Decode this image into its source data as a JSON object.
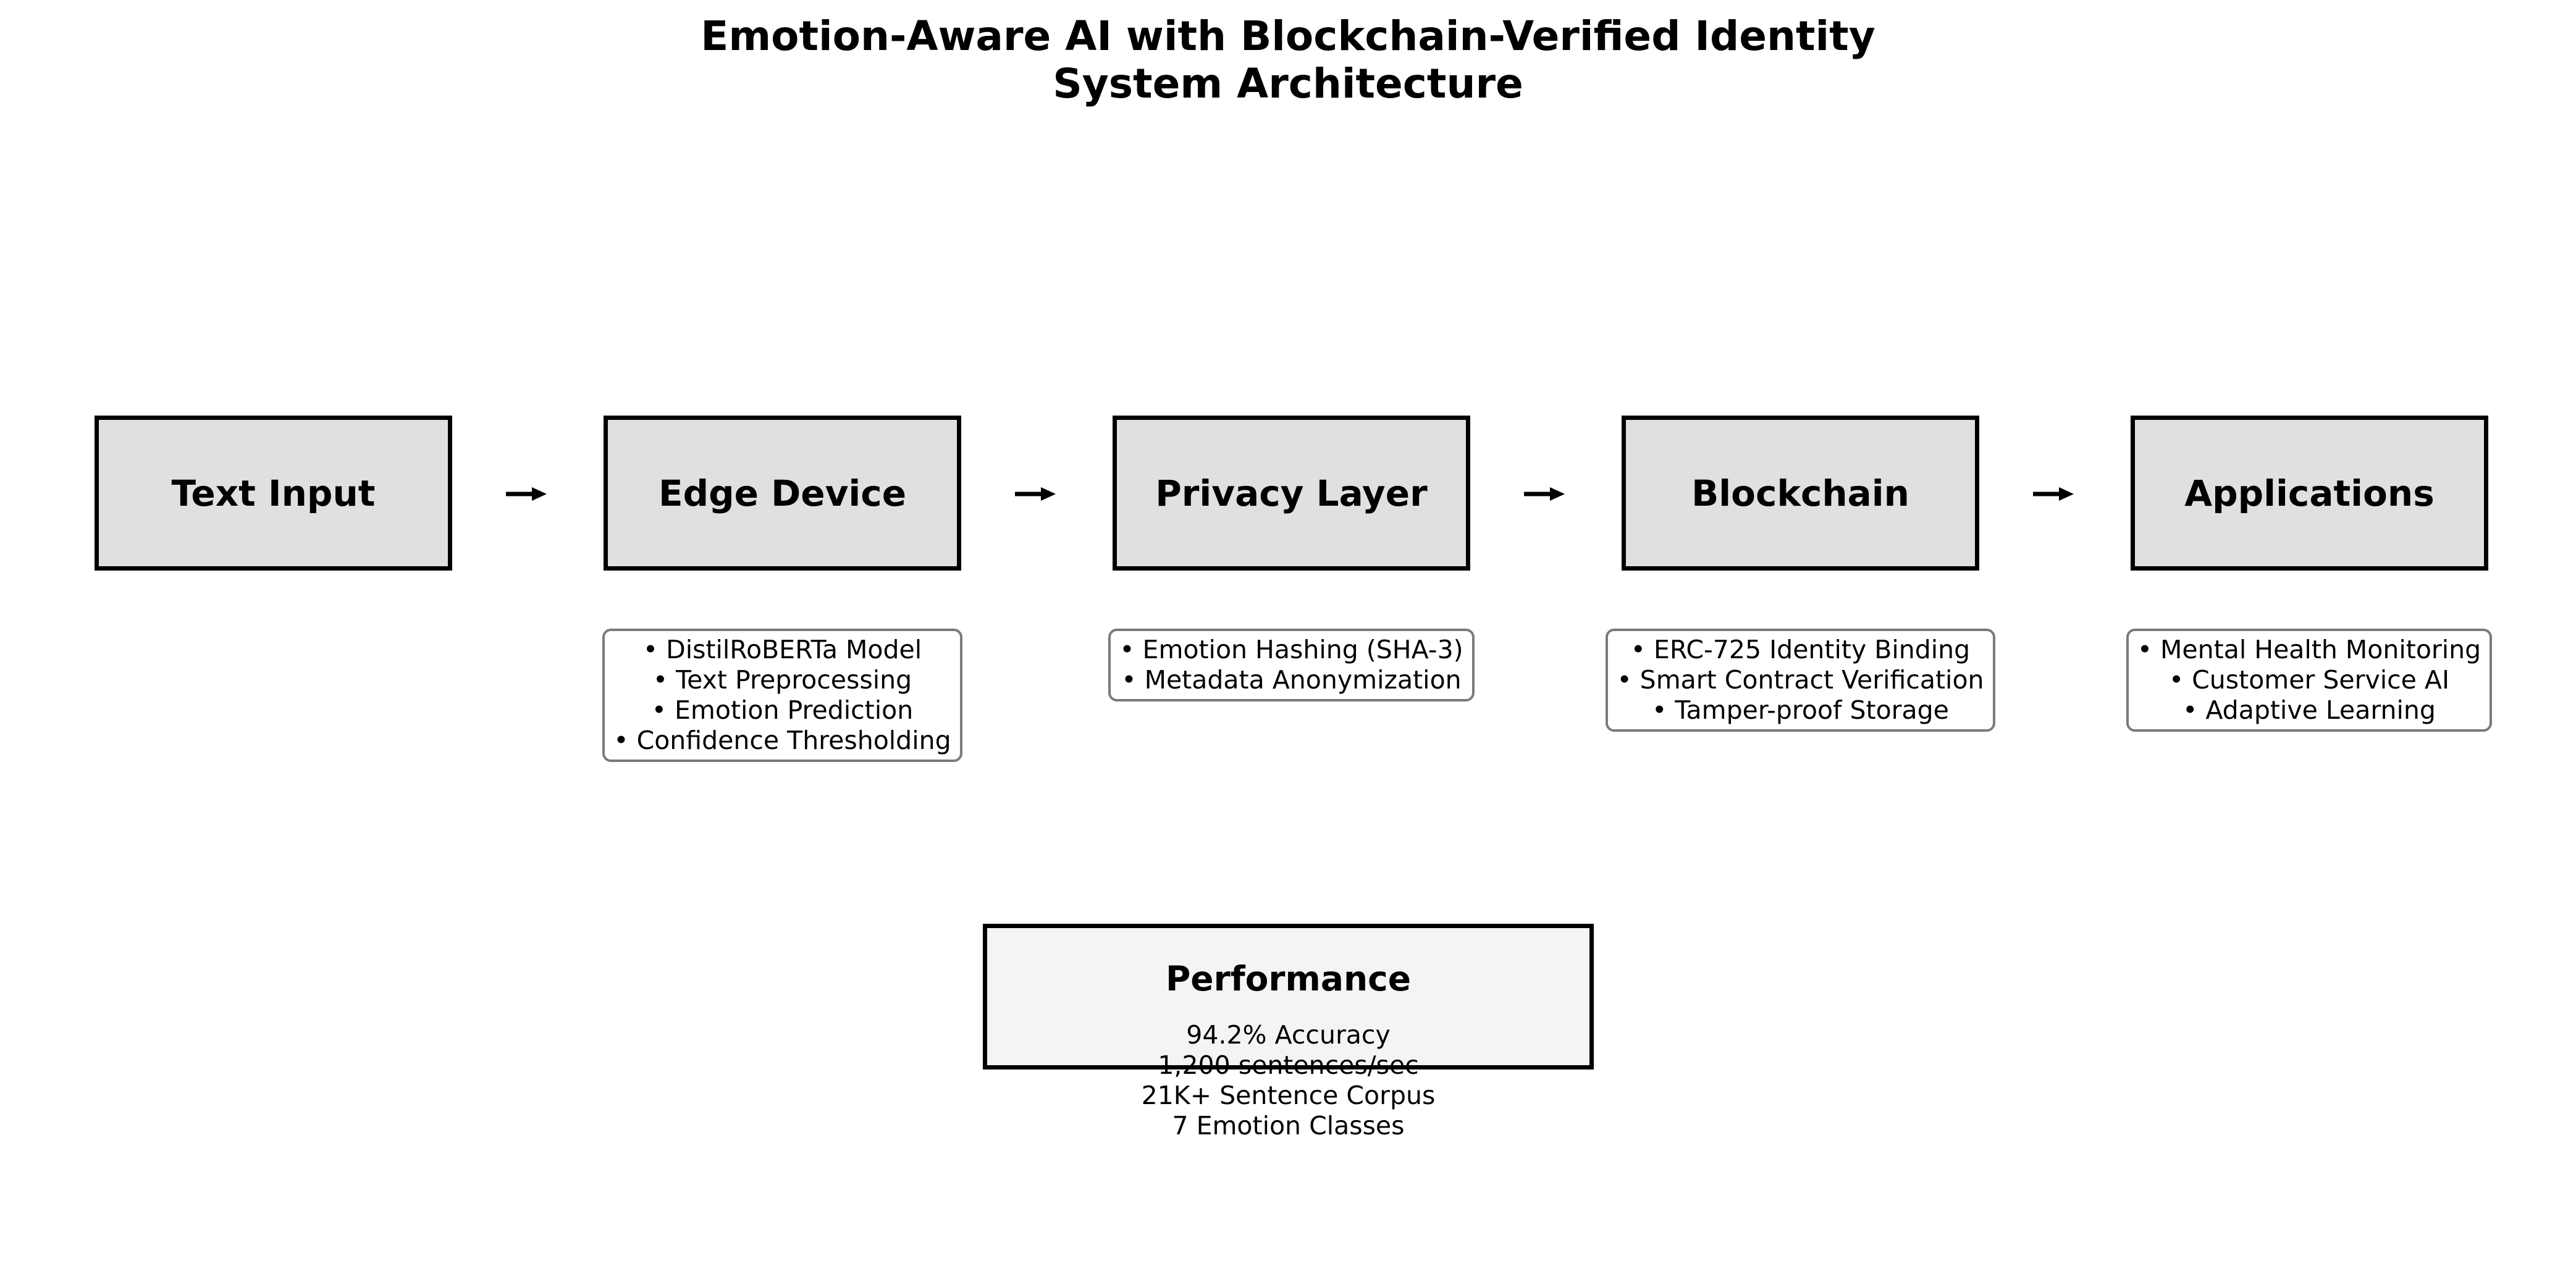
{
  "title": {
    "line1": "Emotion-Aware AI with Blockchain-Verified Identity",
    "line2": "System Architecture"
  },
  "stages": [
    {
      "label": "Text Input",
      "details": []
    },
    {
      "label": "Edge Device",
      "details": [
        "• DistilRoBERTa Model",
        "• Text Preprocessing",
        "• Emotion Prediction",
        "• Confidence Thresholding"
      ]
    },
    {
      "label": "Privacy Layer",
      "details": [
        "• Emotion Hashing (SHA-3)",
        "• Metadata Anonymization"
      ]
    },
    {
      "label": "Blockchain",
      "details": [
        "• ERC-725 Identity Binding",
        "• Smart Contract Verification",
        "• Tamper-proof Storage"
      ]
    },
    {
      "label": "Applications",
      "details": [
        "• Mental Health Monitoring",
        "• Customer Service AI",
        "• Adaptive Learning"
      ]
    }
  ],
  "performance": {
    "title": "Performance",
    "metrics": [
      "94.2% Accuracy",
      "1,200 sentences/sec",
      "21K+ Sentence Corpus",
      "7 Emotion Classes"
    ]
  },
  "colors": {
    "stage_fill": "#e0e0e0",
    "performance_fill": "#f4f4f4",
    "detail_border": "#7a7a7a",
    "stroke": "#000000"
  },
  "icons": {
    "flow_arrow": "right-arrow-icon"
  }
}
